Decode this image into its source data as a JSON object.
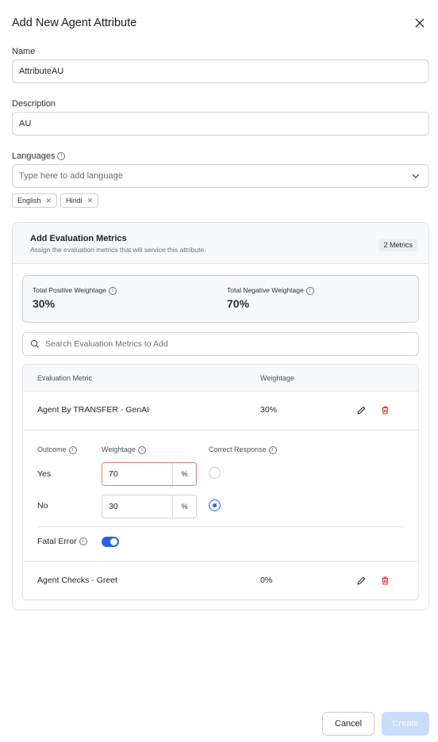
{
  "dialog": {
    "title": "Add New Agent Attribute"
  },
  "form": {
    "name_label": "Name",
    "name_value": "AttributeAU",
    "description_label": "Description",
    "description_value": "AU",
    "languages_label": "Languages",
    "languages_placeholder": "Type here to add language",
    "language_chips": [
      "English",
      "Hindi"
    ]
  },
  "metrics_panel": {
    "title": "Add Evaluation Metrics",
    "subtitle": "Assign the evaluation metrics that will service this attribute.",
    "count_badge": "2 Metrics",
    "total_positive_label": "Total Positive Weightage",
    "total_positive_value": "30%",
    "total_negative_label": "Total Negative Weightage",
    "total_negative_value": "70%",
    "search_placeholder": "Search Evaluation Metrics to Add",
    "columns": [
      "Evaluation Metric",
      "Weightage"
    ],
    "rows": [
      {
        "name": "Agent By TRANSFER - GenAI",
        "weightage": "30%"
      },
      {
        "name": "Agent Checks - Greet",
        "weightage": "0%"
      }
    ],
    "detail": {
      "outcome_label": "Outcome",
      "weightage_label": "Weightage",
      "correct_response_label": "Correct Response",
      "unit": "%",
      "outcomes": [
        {
          "label": "Yes",
          "weightage": "70",
          "correct": false
        },
        {
          "label": "No",
          "weightage": "30",
          "correct": true
        }
      ],
      "fatal_error_label": "Fatal Error",
      "fatal_error_on": true
    }
  },
  "footer": {
    "cancel_label": "Cancel",
    "create_label": "Create"
  },
  "colors": {
    "accent": "#2563eb",
    "danger": "#d93025",
    "create_disabled": "#c9dcfb"
  },
  "icons": [
    "close-icon",
    "info-icon",
    "chevron-down-icon",
    "chip-remove-icon",
    "search-icon",
    "edit-icon",
    "delete-icon"
  ]
}
